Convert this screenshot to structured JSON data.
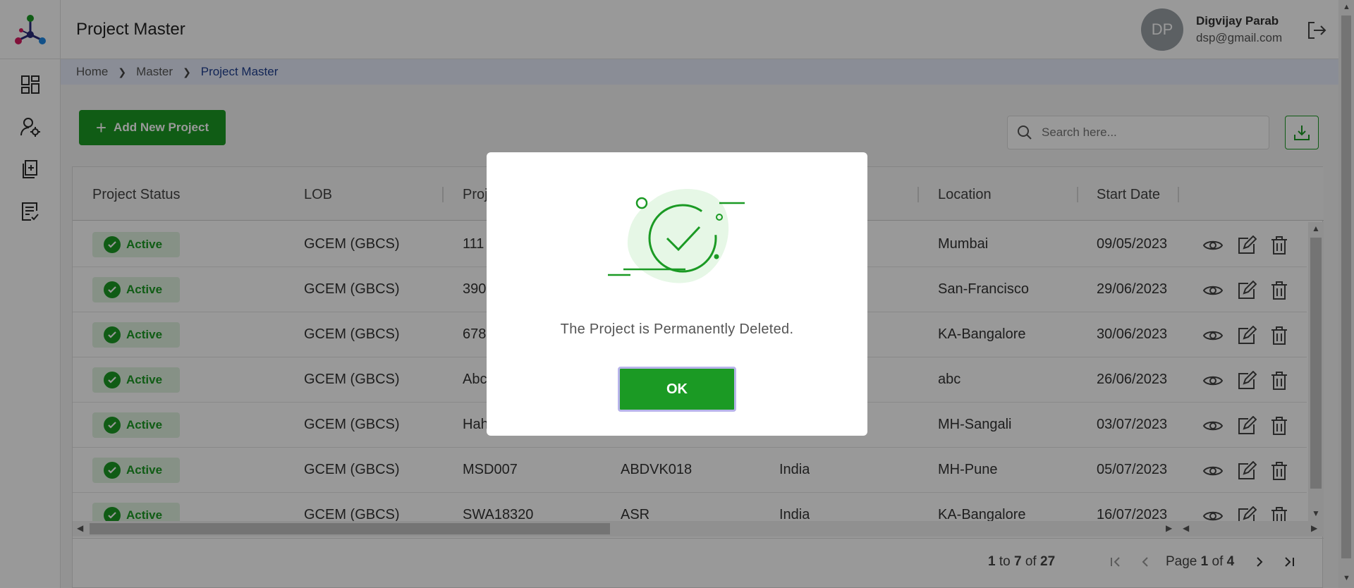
{
  "app": {
    "title": "Project Master"
  },
  "user": {
    "initials": "DP",
    "name": "Digvijay Parab",
    "email": "dsp@gmail.com"
  },
  "breadcrumb": {
    "items": [
      "Home",
      "Master",
      "Project Master"
    ]
  },
  "toolbar": {
    "add_label": "Add New Project",
    "search_placeholder": "Search here..."
  },
  "table": {
    "columns": [
      "Project Status",
      "LOB",
      "Proj",
      "",
      "",
      "Location",
      "Start Date"
    ],
    "rows": [
      {
        "status": "Active",
        "lob": "GCEM (GBCS)",
        "c3": "111",
        "c4": "",
        "c5": "",
        "location": "Mumbai",
        "start_date": "09/05/2023"
      },
      {
        "status": "Active",
        "lob": "GCEM (GBCS)",
        "c3": "390",
        "c4": "",
        "c5": "",
        "location": "San-Francisco",
        "start_date": "29/06/2023"
      },
      {
        "status": "Active",
        "lob": "GCEM (GBCS)",
        "c3": "678",
        "c4": "",
        "c5": "",
        "location": "KA-Bangalore",
        "start_date": "30/06/2023"
      },
      {
        "status": "Active",
        "lob": "GCEM (GBCS)",
        "c3": "Abc",
        "c4": "",
        "c5": "",
        "location": "abc",
        "start_date": "26/06/2023"
      },
      {
        "status": "Active",
        "lob": "GCEM (GBCS)",
        "c3": "Hah",
        "c4": "",
        "c5": "",
        "location": "MH-Sangali",
        "start_date": "03/07/2023"
      },
      {
        "status": "Active",
        "lob": "GCEM (GBCS)",
        "c3": "MSD007",
        "c4": "ABDVK018",
        "c5": "India",
        "location": "MH-Pune",
        "start_date": "05/07/2023"
      },
      {
        "status": "Active",
        "lob": "GCEM (GBCS)",
        "c3": "SWA18320",
        "c4": "ASR",
        "c5": "India",
        "location": "KA-Bangalore",
        "start_date": "16/07/2023"
      }
    ]
  },
  "pagination": {
    "from": "1",
    "to_word": "to",
    "to": "7",
    "of_word": "of",
    "total": "27",
    "page_word": "Page",
    "page": "1",
    "page_of_word": "of",
    "pages": "4"
  },
  "modal": {
    "message": "The Project is Permanently Deleted.",
    "ok_label": "OK"
  },
  "colors": {
    "primary_green": "#1b9a24",
    "badge_bg": "#dff2df",
    "breadcrumb_bg": "#e6ecfa",
    "breadcrumb_active": "#1f3f8f"
  },
  "icons": {
    "logo": "molecule-logo-icon",
    "nav": [
      "dashboard-icon",
      "user-settings-icon",
      "add-document-icon",
      "checklist-icon"
    ],
    "row_actions": [
      "view-eye-icon",
      "edit-icon",
      "delete-trash-icon"
    ]
  }
}
